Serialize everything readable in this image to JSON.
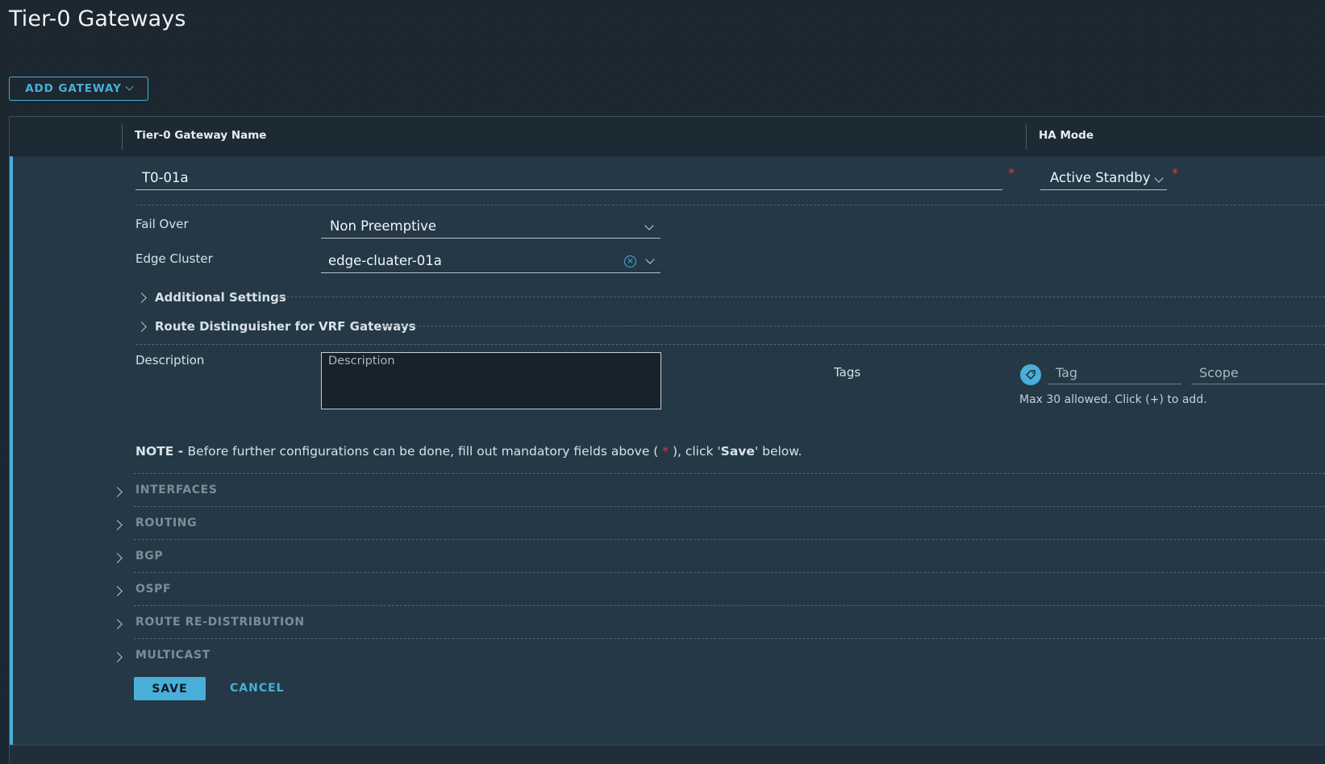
{
  "page": {
    "title": "Tier-0 Gateways"
  },
  "toolbar": {
    "add_gateway_label": "ADD GATEWAY"
  },
  "grid": {
    "columns": [
      "Tier-0 Gateway Name",
      "HA Mode"
    ]
  },
  "form": {
    "name_value": "T0-01a",
    "ha_mode_value": "Active Standby",
    "fail_over": {
      "label": "Fail Over",
      "value": "Non Preemptive"
    },
    "edge_cluster": {
      "label": "Edge Cluster",
      "value": "edge-cluater-01a"
    },
    "additional_settings_label": "Additional Settings",
    "route_distinguisher_label": "Route Distinguisher for VRF Gateways",
    "description": {
      "label": "Description",
      "placeholder": "Description"
    },
    "tags": {
      "label": "Tags",
      "tag_placeholder": "Tag",
      "scope_placeholder": "Scope",
      "hint": "Max 30 allowed. Click (+) to add."
    },
    "note": {
      "prefix": "NOTE - ",
      "text1": "Before further configurations can be done, fill out mandatory fields above ( ",
      "star": "*",
      "text2": " ), click '",
      "save_word": "Save",
      "text3": "' below."
    },
    "sections": [
      "INTERFACES",
      "ROUTING",
      "BGP",
      "OSPF",
      "ROUTE RE-DISTRIBUTION",
      "MULTICAST"
    ],
    "save_label": "SAVE",
    "cancel_label": "CANCEL"
  },
  "colors": {
    "accent": "#49afd9",
    "required": "#e5383b",
    "row_bg": "#243846"
  }
}
